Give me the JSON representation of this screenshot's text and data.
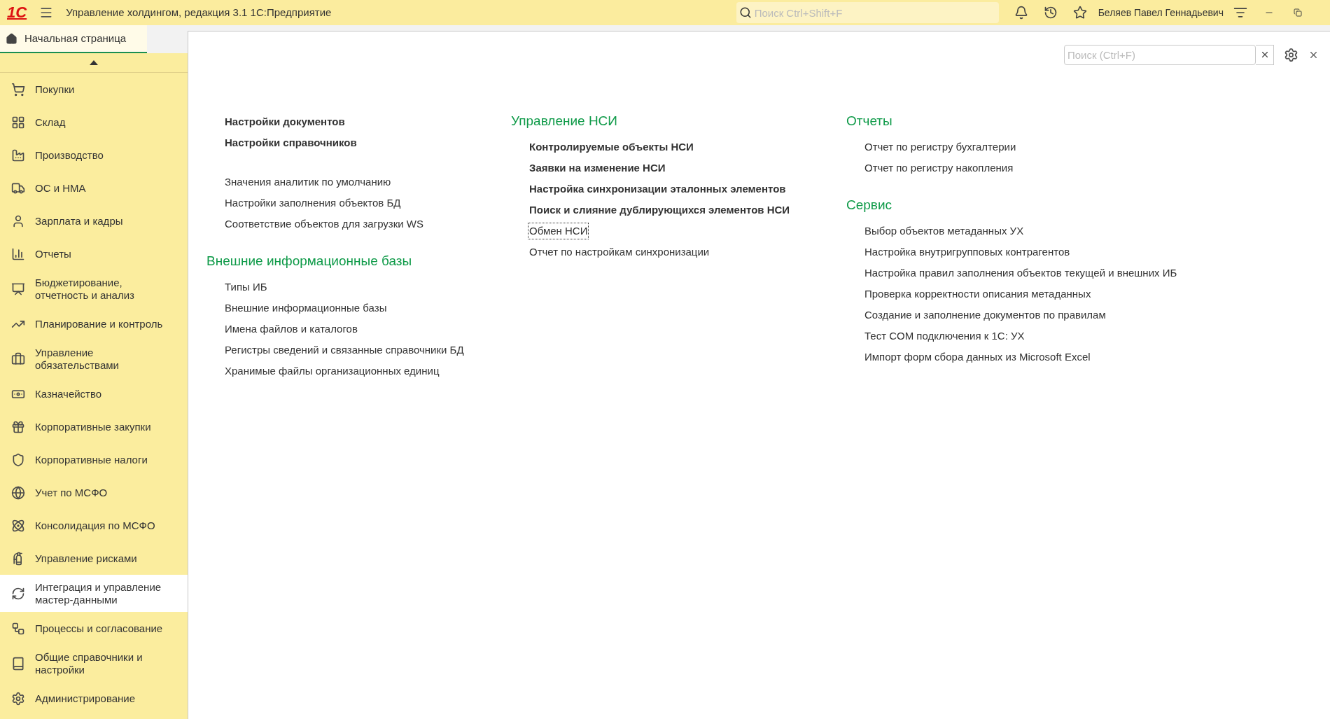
{
  "app_bar": {
    "logo": "1С",
    "title": "Управление холдингом, редакция 3.1 1С:Предприятие",
    "search": {
      "placeholder": "Поиск Ctrl+Shift+F"
    },
    "user": "Беляев Павел Геннадьевич"
  },
  "tabs": [
    {
      "label": "Начальная страница",
      "selected": true
    }
  ],
  "sidebar": {
    "items": [
      {
        "label": "Покупки",
        "selected": false
      },
      {
        "label": "Склад",
        "selected": false
      },
      {
        "label": "Производство",
        "selected": false
      },
      {
        "label": "ОС и НМА",
        "selected": false
      },
      {
        "label": "Зарплата и кадры",
        "selected": false
      },
      {
        "label": "Отчеты",
        "selected": false
      },
      {
        "label": "Бюджетирование,\nотчетность и анализ",
        "selected": false
      },
      {
        "label": "Планирование и контроль",
        "selected": false
      },
      {
        "label": "Управление\nобязательствами",
        "selected": false
      },
      {
        "label": "Казначейство",
        "selected": false
      },
      {
        "label": "Корпоративные закупки",
        "selected": false
      },
      {
        "label": "Корпоративные налоги",
        "selected": false
      },
      {
        "label": "Учет по МСФО",
        "selected": false
      },
      {
        "label": "Консолидация по МСФО",
        "selected": false
      },
      {
        "label": "Управление рисками",
        "selected": false
      },
      {
        "label": "Интеграция и управление\nмастер-данными",
        "selected": true
      },
      {
        "label": "Процессы и согласование",
        "selected": false
      },
      {
        "label": "Общие справочники и\nнастройки",
        "selected": false
      },
      {
        "label": "Администрирование",
        "selected": false
      }
    ]
  },
  "content": {
    "search": {
      "placeholder": "Поиск (Ctrl+F)"
    },
    "columns": [
      {
        "sections": [
          {
            "items": [
              {
                "label": "Настройки документов",
                "kind": "important",
                "focused": false
              },
              {
                "label": "Настройки справочников",
                "kind": "important",
                "focused": false
              }
            ]
          },
          {
            "items": [
              {
                "label": "Значения аналитик по умолчанию",
                "kind": "regular",
                "focused": false
              },
              {
                "label": "Настройки заполнения объектов БД",
                "kind": "regular",
                "focused": false
              },
              {
                "label": "Соответствие объектов для загрузки WS",
                "kind": "regular",
                "focused": false
              }
            ]
          },
          {
            "heading": "Внешние информационные базы",
            "items": [
              {
                "label": "Типы ИБ",
                "kind": "regular",
                "focused": false
              },
              {
                "label": "Внешние информационные базы",
                "kind": "regular",
                "focused": false
              },
              {
                "label": "Имена файлов и каталогов",
                "kind": "regular",
                "focused": false
              },
              {
                "label": "Регистры сведений и связанные справочники БД",
                "kind": "regular",
                "focused": false
              },
              {
                "label": "Хранимые файлы организационных единиц",
                "kind": "regular",
                "focused": false
              }
            ]
          }
        ]
      },
      {
        "sections": [
          {
            "heading": "Управление НСИ",
            "items": [
              {
                "label": "Контролируемые объекты НСИ",
                "kind": "important",
                "focused": false
              },
              {
                "label": "Заявки на изменение НСИ",
                "kind": "important",
                "focused": false
              },
              {
                "label": "Настройка синхронизации эталонных элементов",
                "kind": "important",
                "focused": false
              },
              {
                "label": "Поиск и слияние дублирующихся элементов НСИ",
                "kind": "important",
                "focused": false
              },
              {
                "label": "Обмен НСИ",
                "kind": "regular",
                "focused": true
              },
              {
                "label": "Отчет по настройкам синхронизации",
                "kind": "regular",
                "focused": false
              }
            ]
          }
        ]
      },
      {
        "sections": [
          {
            "heading": "Отчеты",
            "items": [
              {
                "label": "Отчет по регистру бухгалтерии",
                "kind": "regular",
                "focused": false
              },
              {
                "label": "Отчет по регистру накопления",
                "kind": "regular",
                "focused": false
              }
            ]
          },
          {
            "heading": "Сервис",
            "items": [
              {
                "label": "Выбор объектов метаданных УХ",
                "kind": "regular",
                "focused": false
              },
              {
                "label": "Настройка внутригрупповых контрагентов",
                "kind": "regular",
                "focused": false
              },
              {
                "label": "Настройка правил заполнения объектов текущей и внешних ИБ",
                "kind": "regular",
                "focused": false
              },
              {
                "label": "Проверка корректности описания метаданных",
                "kind": "regular",
                "focused": false
              },
              {
                "label": "Создание и заполнение документов по правилам",
                "kind": "regular",
                "focused": false
              },
              {
                "label": "Тест COM подключения к 1С: УХ",
                "kind": "regular",
                "focused": false
              },
              {
                "label": "Импорт форм сбора данных из Microsoft Excel",
                "kind": "regular",
                "focused": false
              }
            ]
          }
        ]
      }
    ]
  }
}
